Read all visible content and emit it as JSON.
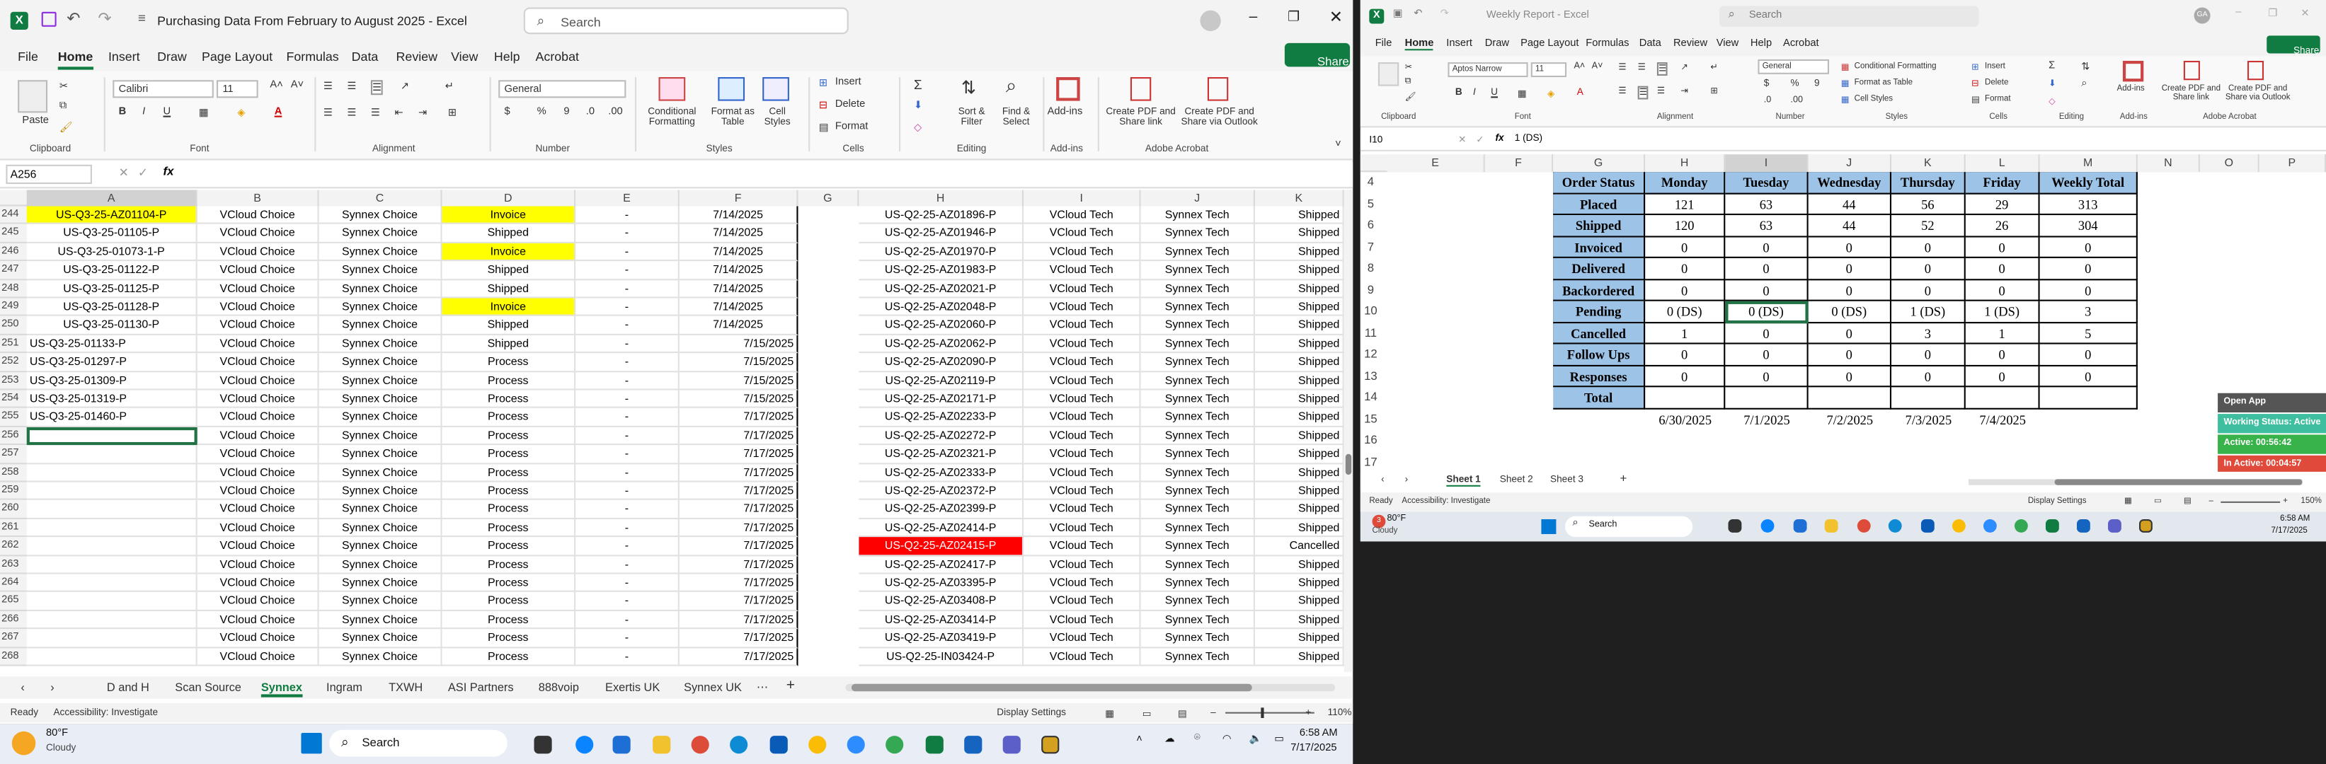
{
  "left_window": {
    "title": "Purchasing Data From February to August 2025 - Excel",
    "search_placeholder": "Search",
    "menu": [
      "File",
      "Home",
      "Insert",
      "Draw",
      "Page Layout",
      "Formulas",
      "Data",
      "Review",
      "View",
      "Help",
      "Acrobat"
    ],
    "share_label": "Share",
    "ribbon": {
      "clipboard": {
        "paste": "Paste",
        "group": "Clipboard"
      },
      "font": {
        "name": "Calibri",
        "size": "11",
        "group": "Font"
      },
      "alignment": {
        "group": "Alignment"
      },
      "number": {
        "format": "General",
        "group": "Number"
      },
      "styles": {
        "cond": "Conditional Formatting",
        "table": "Format as Table",
        "cell": "Cell Styles",
        "group": "Styles"
      },
      "cells": {
        "insert": "Insert",
        "delete": "Delete",
        "format": "Format",
        "group": "Cells"
      },
      "editing": {
        "sort": "Sort & Filter",
        "find": "Find & Select",
        "group": "Editing"
      },
      "addins": {
        "label": "Add-ins",
        "group": "Add-ins"
      },
      "acrobat": {
        "pdf1": "Create PDF and Share link",
        "pdf2": "Create PDF and Share via Outlook",
        "group": "Adobe Acrobat"
      }
    },
    "name_box": "A256",
    "fx_label": "fx",
    "columns": [
      "A",
      "B",
      "C",
      "D",
      "E",
      "F",
      "G",
      "H",
      "I",
      "J",
      "K"
    ],
    "rows": [
      {
        "n": "244",
        "a": "US-Q3-25-AZ01104-P",
        "b": "VCloud Choice",
        "c": "Synnex Choice",
        "d": "Invoice",
        "e": "-",
        "f": "7/14/2025",
        "h": "US-Q2-25-AZ01896-P",
        "i": "VCloud Tech",
        "j": "Synnex Tech",
        "k": "Shipped"
      },
      {
        "n": "245",
        "a": "US-Q3-25-01105-P",
        "b": "VCloud Choice",
        "c": "Synnex Choice",
        "d": "Shipped",
        "e": "-",
        "f": "7/14/2025",
        "h": "US-Q2-25-AZ01946-P",
        "i": "VCloud Tech",
        "j": "Synnex Tech",
        "k": "Shipped"
      },
      {
        "n": "246",
        "a": "US-Q3-25-01073-1-P",
        "b": "VCloud Choice",
        "c": "Synnex Choice",
        "d": "Invoice",
        "e": "-",
        "f": "7/14/2025",
        "h": "US-Q2-25-AZ01970-P",
        "i": "VCloud Tech",
        "j": "Synnex Tech",
        "k": "Shipped"
      },
      {
        "n": "247",
        "a": "US-Q3-25-01122-P",
        "b": "VCloud Choice",
        "c": "Synnex Choice",
        "d": "Shipped",
        "e": "-",
        "f": "7/14/2025",
        "h": "US-Q2-25-AZ01983-P",
        "i": "VCloud Tech",
        "j": "Synnex Tech",
        "k": "Shipped"
      },
      {
        "n": "248",
        "a": "US-Q3-25-01125-P",
        "b": "VCloud Choice",
        "c": "Synnex Choice",
        "d": "Shipped",
        "e": "-",
        "f": "7/14/2025",
        "h": "US-Q2-25-AZ02021-P",
        "i": "VCloud Tech",
        "j": "Synnex Tech",
        "k": "Shipped"
      },
      {
        "n": "249",
        "a": "US-Q3-25-01128-P",
        "b": "VCloud Choice",
        "c": "Synnex Choice",
        "d": "Invoice",
        "e": "-",
        "f": "7/14/2025",
        "h": "US-Q2-25-AZ02048-P",
        "i": "VCloud Tech",
        "j": "Synnex Tech",
        "k": "Shipped"
      },
      {
        "n": "250",
        "a": "US-Q3-25-01130-P",
        "b": "VCloud Choice",
        "c": "Synnex Choice",
        "d": "Shipped",
        "e": "-",
        "f": "7/14/2025",
        "h": "US-Q2-25-AZ02060-P",
        "i": "VCloud Tech",
        "j": "Synnex Tech",
        "k": "Shipped"
      },
      {
        "n": "251",
        "a": "US-Q3-25-01133-P",
        "b": "VCloud Choice",
        "c": "Synnex Choice",
        "d": "Shipped",
        "e": "-",
        "f": "7/15/2025",
        "h": "US-Q2-25-AZ02062-P",
        "i": "VCloud Tech",
        "j": "Synnex Tech",
        "k": "Shipped"
      },
      {
        "n": "252",
        "a": "US-Q3-25-01297-P",
        "b": "VCloud Choice",
        "c": "Synnex Choice",
        "d": "Process",
        "e": "-",
        "f": "7/15/2025",
        "h": "US-Q2-25-AZ02090-P",
        "i": "VCloud Tech",
        "j": "Synnex Tech",
        "k": "Shipped"
      },
      {
        "n": "253",
        "a": "US-Q3-25-01309-P",
        "b": "VCloud Choice",
        "c": "Synnex Choice",
        "d": "Process",
        "e": "-",
        "f": "7/15/2025",
        "h": "US-Q2-25-AZ02119-P",
        "i": "VCloud Tech",
        "j": "Synnex Tech",
        "k": "Shipped"
      },
      {
        "n": "254",
        "a": "US-Q3-25-01319-P",
        "b": "VCloud Choice",
        "c": "Synnex Choice",
        "d": "Process",
        "e": "-",
        "f": "7/15/2025",
        "h": "US-Q2-25-AZ02171-P",
        "i": "VCloud Tech",
        "j": "Synnex Tech",
        "k": "Shipped"
      },
      {
        "n": "255",
        "a": "US-Q3-25-01460-P",
        "b": "VCloud Choice",
        "c": "Synnex Choice",
        "d": "Process",
        "e": "-",
        "f": "7/17/2025",
        "h": "US-Q2-25-AZ02233-P",
        "i": "VCloud Tech",
        "j": "Synnex Tech",
        "k": "Shipped"
      },
      {
        "n": "256",
        "a": "",
        "b": "VCloud Choice",
        "c": "Synnex Choice",
        "d": "Process",
        "e": "-",
        "f": "7/17/2025",
        "h": "US-Q2-25-AZ02272-P",
        "i": "VCloud Tech",
        "j": "Synnex Tech",
        "k": "Shipped"
      },
      {
        "n": "257",
        "a": "",
        "b": "VCloud Choice",
        "c": "Synnex Choice",
        "d": "Process",
        "e": "-",
        "f": "7/17/2025",
        "h": "US-Q2-25-AZ02321-P",
        "i": "VCloud Tech",
        "j": "Synnex Tech",
        "k": "Shipped"
      },
      {
        "n": "258",
        "a": "",
        "b": "VCloud Choice",
        "c": "Synnex Choice",
        "d": "Process",
        "e": "-",
        "f": "7/17/2025",
        "h": "US-Q2-25-AZ02333-P",
        "i": "VCloud Tech",
        "j": "Synnex Tech",
        "k": "Shipped"
      },
      {
        "n": "259",
        "a": "",
        "b": "VCloud Choice",
        "c": "Synnex Choice",
        "d": "Process",
        "e": "-",
        "f": "7/17/2025",
        "h": "US-Q2-25-AZ02372-P",
        "i": "VCloud Tech",
        "j": "Synnex Tech",
        "k": "Shipped"
      },
      {
        "n": "260",
        "a": "",
        "b": "VCloud Choice",
        "c": "Synnex Choice",
        "d": "Process",
        "e": "-",
        "f": "7/17/2025",
        "h": "US-Q2-25-AZ02399-P",
        "i": "VCloud Tech",
        "j": "Synnex Tech",
        "k": "Shipped"
      },
      {
        "n": "261",
        "a": "",
        "b": "VCloud Choice",
        "c": "Synnex Choice",
        "d": "Process",
        "e": "-",
        "f": "7/17/2025",
        "h": "US-Q2-25-AZ02414-P",
        "i": "VCloud Tech",
        "j": "Synnex Tech",
        "k": "Shipped"
      },
      {
        "n": "262",
        "a": "",
        "b": "VCloud Choice",
        "c": "Synnex Choice",
        "d": "Process",
        "e": "-",
        "f": "7/17/2025",
        "h": "US-Q2-25-AZ02415-P",
        "i": "VCloud Tech",
        "j": "Synnex Tech",
        "k": "Cancelled"
      },
      {
        "n": "263",
        "a": "",
        "b": "VCloud Choice",
        "c": "Synnex Choice",
        "d": "Process",
        "e": "-",
        "f": "7/17/2025",
        "h": "US-Q2-25-AZ02417-P",
        "i": "VCloud Tech",
        "j": "Synnex Tech",
        "k": "Shipped"
      },
      {
        "n": "264",
        "a": "",
        "b": "VCloud Choice",
        "c": "Synnex Choice",
        "d": "Process",
        "e": "-",
        "f": "7/17/2025",
        "h": "US-Q2-25-AZ03395-P",
        "i": "VCloud Tech",
        "j": "Synnex Tech",
        "k": "Shipped"
      },
      {
        "n": "265",
        "a": "",
        "b": "VCloud Choice",
        "c": "Synnex Choice",
        "d": "Process",
        "e": "-",
        "f": "7/17/2025",
        "h": "US-Q2-25-AZ03408-P",
        "i": "VCloud Tech",
        "j": "Synnex Tech",
        "k": "Shipped"
      },
      {
        "n": "266",
        "a": "",
        "b": "VCloud Choice",
        "c": "Synnex Choice",
        "d": "Process",
        "e": "-",
        "f": "7/17/2025",
        "h": "US-Q2-25-AZ03414-P",
        "i": "VCloud Tech",
        "j": "Synnex Tech",
        "k": "Shipped"
      },
      {
        "n": "267",
        "a": "",
        "b": "VCloud Choice",
        "c": "Synnex Choice",
        "d": "Process",
        "e": "-",
        "f": "7/17/2025",
        "h": "US-Q2-25-AZ03419-P",
        "i": "VCloud Tech",
        "j": "Synnex Tech",
        "k": "Shipped"
      },
      {
        "n": "268",
        "a": "",
        "b": "VCloud Choice",
        "c": "Synnex Choice",
        "d": "Process",
        "e": "-",
        "f": "7/17/2025",
        "h": "US-Q2-25-IN03424-P",
        "i": "VCloud Tech",
        "j": "Synnex Tech",
        "k": "Shipped"
      }
    ],
    "sheet_tabs": [
      "D and H",
      "Scan Source",
      "Synnex",
      "Ingram",
      "TXWH",
      "ASI Partners",
      "888voip",
      "Exertis UK",
      "Synnex UK"
    ],
    "active_tab": "Synnex",
    "status": {
      "ready": "Ready",
      "accessibility": "Accessibility: Investigate",
      "display": "Display Settings",
      "zoom": "110%"
    },
    "colors": {
      "yellow": "#ffff00",
      "red": "#ff0000",
      "accent": "#107c41",
      "active_cell_border": "#217346"
    }
  },
  "right_window": {
    "title": "Weekly Report - Excel",
    "search_placeholder": "Search",
    "avatar": "GA",
    "menu": [
      "File",
      "Home",
      "Insert",
      "Draw",
      "Page Layout",
      "Formulas",
      "Data",
      "Review",
      "View",
      "Help",
      "Acrobat"
    ],
    "share_label": "Share",
    "font": {
      "name": "Aptos Narrow",
      "size": "11"
    },
    "number_format": "General",
    "ribbon_labels": {
      "cond": "Conditional Formatting",
      "table": "Format as Table",
      "cellstyles": "Cell Styles",
      "insert": "Insert",
      "delete": "Delete",
      "format": "Format",
      "addins": "Add-ins",
      "pdf1": "Create PDF and Share link",
      "pdf2": "Create PDF and Share via Outlook",
      "groups": [
        "Clipboard",
        "Font",
        "Alignment",
        "Number",
        "Styles",
        "Cells",
        "Editing",
        "Add-ins",
        "Adobe Acrobat"
      ]
    },
    "name_box": "I10",
    "formula": "1 (DS)",
    "columns": [
      "E",
      "F",
      "G",
      "H",
      "I",
      "J",
      "K",
      "L",
      "M",
      "N",
      "O",
      "P"
    ],
    "row_numbers": [
      "4",
      "5",
      "6",
      "7",
      "8",
      "9",
      "10",
      "11",
      "12",
      "13",
      "14",
      "15",
      "16",
      "17"
    ],
    "table": {
      "header": [
        "Order Status",
        "Monday",
        "Tuesday",
        "Wednesday",
        "Thursday",
        "Friday",
        "Weekly Total"
      ],
      "rows": [
        [
          "Placed",
          "121",
          "63",
          "44",
          "56",
          "29",
          "313"
        ],
        [
          "Shipped",
          "120",
          "63",
          "44",
          "52",
          "26",
          "304"
        ],
        [
          "Invoiced",
          "0",
          "0",
          "0",
          "0",
          "0",
          "0"
        ],
        [
          "Delivered",
          "0",
          "0",
          "0",
          "0",
          "0",
          "0"
        ],
        [
          "Backordered",
          "0",
          "0",
          "0",
          "0",
          "0",
          "0"
        ],
        [
          "Pending",
          "0 (DS)",
          "0 (DS)",
          "0 (DS)",
          "1 (DS)",
          "1 (DS)",
          "3"
        ],
        [
          "Cancelled",
          "1",
          "0",
          "0",
          "3",
          "1",
          "5"
        ],
        [
          "Follow Ups",
          "0",
          "0",
          "0",
          "0",
          "0",
          "0"
        ],
        [
          "Responses",
          "0",
          "0",
          "0",
          "0",
          "0",
          "0"
        ],
        [
          "Total",
          "",
          "",
          "",
          "",
          "",
          ""
        ]
      ],
      "dates": [
        "6/30/2025",
        "7/1/2025",
        "7/2/2025",
        "7/3/2025",
        "7/4/2025"
      ]
    },
    "overlay": {
      "open_app": "Open App",
      "working": "Working Status: Active",
      "active": "Active: 00:56:42",
      "inactive": "In Active: 00:04:57"
    },
    "sheet_tabs": [
      "Sheet 1",
      "Sheet 2",
      "Sheet 3"
    ],
    "status": {
      "ready": "Ready",
      "accessibility": "Accessibility: Investigate",
      "display": "Display Settings",
      "zoom": "150%"
    }
  },
  "taskbar_left": {
    "weather_temp": "80°F",
    "weather_text": "Cloudy",
    "search": "Search",
    "time": "6:58 AM",
    "date": "7/17/2025"
  },
  "taskbar_right": {
    "weather_temp": "80°F",
    "weather_text": "Cloudy",
    "search": "Search",
    "time": "6:58 AM",
    "date": "7/17/2025",
    "badge": "3"
  }
}
